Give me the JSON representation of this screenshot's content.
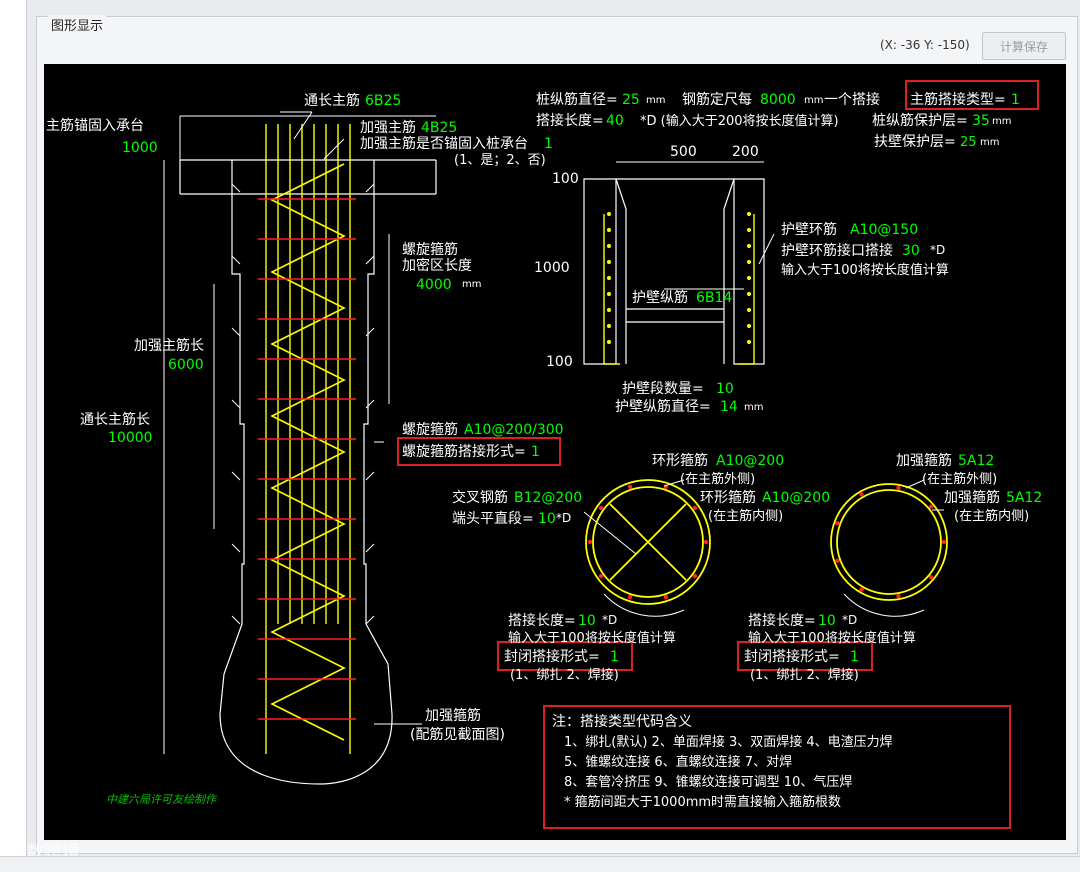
{
  "window": {
    "panel_title": "图形显示",
    "coords": "(X: -36 Y: -150)",
    "calc_save_button": "计算保存",
    "watermark": "大数跨境"
  },
  "colors": {
    "canvas_bg": "#000000",
    "white": "#ffffff",
    "green": "#00ff00",
    "yellow": "#ffff00",
    "red": "#ff2020",
    "highlight_box": "#e02020"
  },
  "drawing": {
    "tong_main": "通长主筋",
    "tong_main_val": "6B25",
    "anchor_label": "主筋锚固入承台",
    "anchor_val": "1000",
    "jq_main": "加强主筋",
    "jq_main_val": "4B25",
    "jq_anchor_q": "加强主筋是否锚固入桩承台",
    "jq_anchor_val": "1",
    "jq_anchor_opts": "(1、是；2、否)",
    "spiral_dense": "螺旋箍筋",
    "spiral_dense2": "加密区长度",
    "spiral_dense_val": "4000",
    "unit_mm": "mm",
    "jq_len": "加强主筋长",
    "jq_len_val": "6000",
    "tong_len": "通长主筋长",
    "tong_len_val": "10000",
    "spiral": "螺旋箍筋",
    "spiral_val": "A10@200/300",
    "spiral_lap": "螺旋箍筋搭接形式=",
    "spiral_lap_val": "1",
    "jq_hoop": "加强箍筋",
    "jq_hoop_note": "(配筋见截面图)",
    "author": "中建六局许可友绘制作",
    "pile_dia": "桩纵筋直径=",
    "pile_dia_val": "25",
    "steel_len": "钢筋定尺每",
    "steel_len_val": "8000",
    "steel_len_suffix": "一个搭接",
    "main_lap_type": "主筋搭接类型=",
    "main_lap_type_val": "1",
    "lap_len": "搭接长度=",
    "lap_len_val": "40",
    "lap_len_note": "*D (输入大于200将按长度值计算)",
    "pile_cover": "桩纵筋保护层=",
    "pile_cover_val": "35",
    "wall_cover": "扶壁保护层=",
    "wall_cover_val": "25",
    "dim_500": "500",
    "dim_200": "200",
    "dim_100_top": "100",
    "dim_1000": "1000",
    "dim_100_bot": "100",
    "wall_ring": "护壁环筋",
    "wall_ring_val": "A10@150",
    "wall_ring_lap": "护壁环筋接口搭接",
    "wall_ring_lap_val": "30",
    "wall_ring_lap_unit": "*D",
    "wall_ring_lap_note": "输入大于100将按长度值计算",
    "wall_long": "护壁纵筋",
    "wall_long_val": "6B14",
    "wall_seg_count": "护壁段数量=",
    "wall_seg_count_val": "10",
    "wall_long_dia": "护壁纵筋直径=",
    "wall_long_dia_val": "14",
    "ring_hoop": "环形箍筋",
    "ring_hoop_val": "A10@200",
    "ring_hoop_outer": "(在主筋外侧)",
    "cross_bar": "交叉钢筋",
    "cross_bar_val": "B12@200",
    "ring_hoop_in": "环形箍筋",
    "ring_hoop_in_val": "A10@200",
    "ring_hoop_inner": "(在主筋内侧)",
    "end_straight": "端头平直段=",
    "end_straight_val": "10",
    "end_straight_unit": "*D",
    "jq_hoop_r": "加强箍筋",
    "jq_hoop_r_val": "5A12",
    "jq_hoop_r_outer": "(在主筋外侧)",
    "jq_hoop_r2": "加强箍筋",
    "jq_hoop_r2_val": "5A12",
    "jq_hoop_r2_inner": "(在主筋内侧)",
    "lap_len_l": "搭接长度=",
    "lap_len_l_val": "10",
    "lap_len_l_unit": "*D",
    "lap_note_l": "输入大于100将按长度值计算",
    "closed_lap_l": "封闭搭接形式=",
    "closed_lap_l_val": "1",
    "closed_opts_l": "(1、绑扎  2、焊接)",
    "lap_len_r": "搭接长度=",
    "lap_len_r_val": "10",
    "lap_len_r_unit": "*D",
    "lap_note_r": "输入大于100将按长度值计算",
    "closed_lap_r": "封闭搭接形式=",
    "closed_lap_r_val": "1",
    "closed_opts_r": "(1、绑扎  2、焊接)",
    "note_title": "注：搭接类型代码含义",
    "note_line1": "1、绑扎(默认)    2、单面焊接    3、双面焊接    4、电渣压力焊",
    "note_line2": "5、锥螺纹连接    6、直螺纹连接    7、对焊",
    "note_line3": "8、套管冷挤压    9、锥螺纹连接可调型    10、气压焊",
    "note_line4": "* 箍筋间距大于1000mm时需直接输入箍筋根数"
  }
}
